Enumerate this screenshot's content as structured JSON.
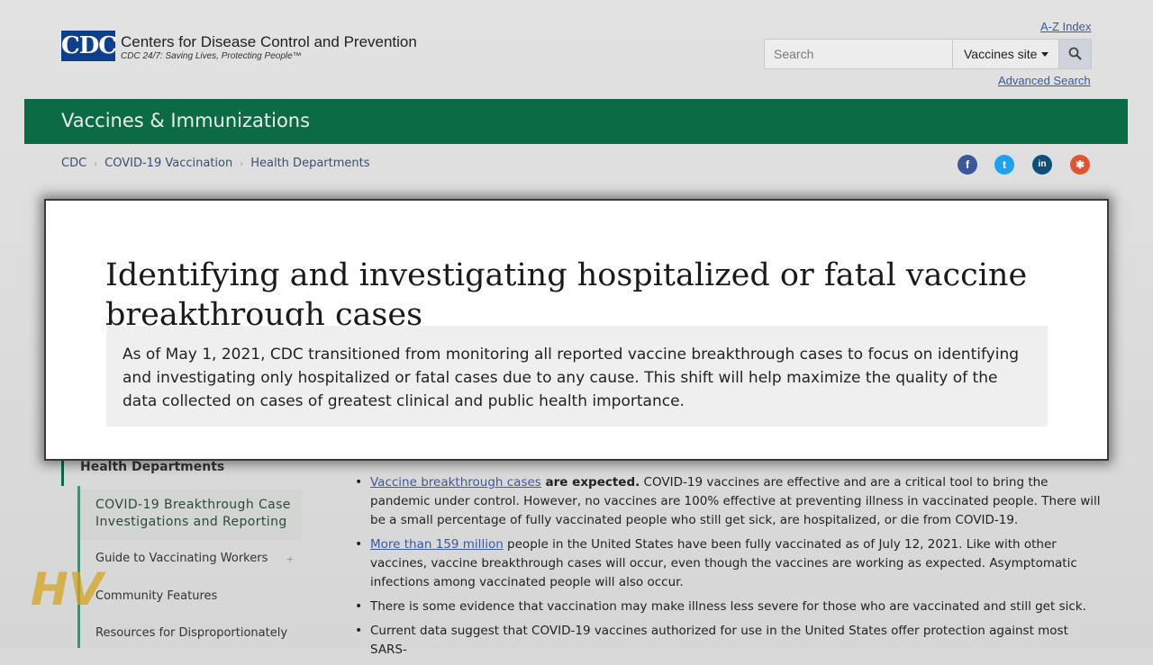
{
  "header": {
    "logo_text": "CDC",
    "org_name": "Centers for Disease Control and Prevention",
    "tagline": "CDC 24/7: Saving Lives, Protecting People™",
    "az_index": "A-Z Index",
    "search_placeholder": "Search",
    "site_select": "Vaccines site",
    "advanced_search": "Advanced Search"
  },
  "banner": {
    "title": "Vaccines & Immunizations"
  },
  "breadcrumb": [
    "CDC",
    "COVID-19 Vaccination",
    "Health Departments"
  ],
  "social": [
    {
      "icon": "facebook-icon",
      "glyph": "f",
      "color": "#3b5998"
    },
    {
      "icon": "twitter-icon",
      "glyph": "t",
      "color": "#1da1f2"
    },
    {
      "icon": "linkedin-icon",
      "glyph": "in",
      "color": "#0e4f7a"
    },
    {
      "icon": "syndicate-icon",
      "glyph": "✱",
      "color": "#e2562f"
    }
  ],
  "card": {
    "title": "Identifying and investigating hospitalized or fatal vaccine breakthrough cases",
    "body": "As of May 1, 2021, CDC transitioned from monitoring all reported vaccine breakthrough cases to focus on identifying and investigating only hospitalized or fatal cases due to any cause. This shift will help maximize the quality of the data collected on cases of greatest clinical and public health importance."
  },
  "sidebar": {
    "heading": "Health Departments",
    "active": "COVID-19 Breakthrough Case Investigations and Reporting",
    "items": [
      "Guide to Vaccinating Workers",
      "Community Features",
      "Resources for Disproportionately"
    ],
    "expand_glyph": "+"
  },
  "main": {
    "item1_link": "Vaccine breakthrough cases",
    "item1_bold": " are expected.",
    "item1_text": " COVID-19 vaccines are effective and are a critical tool to bring the pandemic under control. However, no vaccines are 100% effective at preventing illness in vaccinated people. There will be a small percentage of fully vaccinated people who still get sick, are hospitalized, or die from COVID-19.",
    "item2_link": "More than 159 million",
    "item2_text": " people in the United States have been fully vaccinated as of July 12, 2021. Like with other vaccines, vaccine breakthrough cases will occur, even though the vaccines are working as expected. Asymptomatic infections among vaccinated people will also occur.",
    "item3_text": "There is some evidence that vaccination may make illness less severe for those who are vaccinated and still get sick.",
    "item4_text": "Current data suggest that COVID-19 vaccines authorized for use in the United States offer protection against most SARS-"
  },
  "watermark_text": "HV"
}
